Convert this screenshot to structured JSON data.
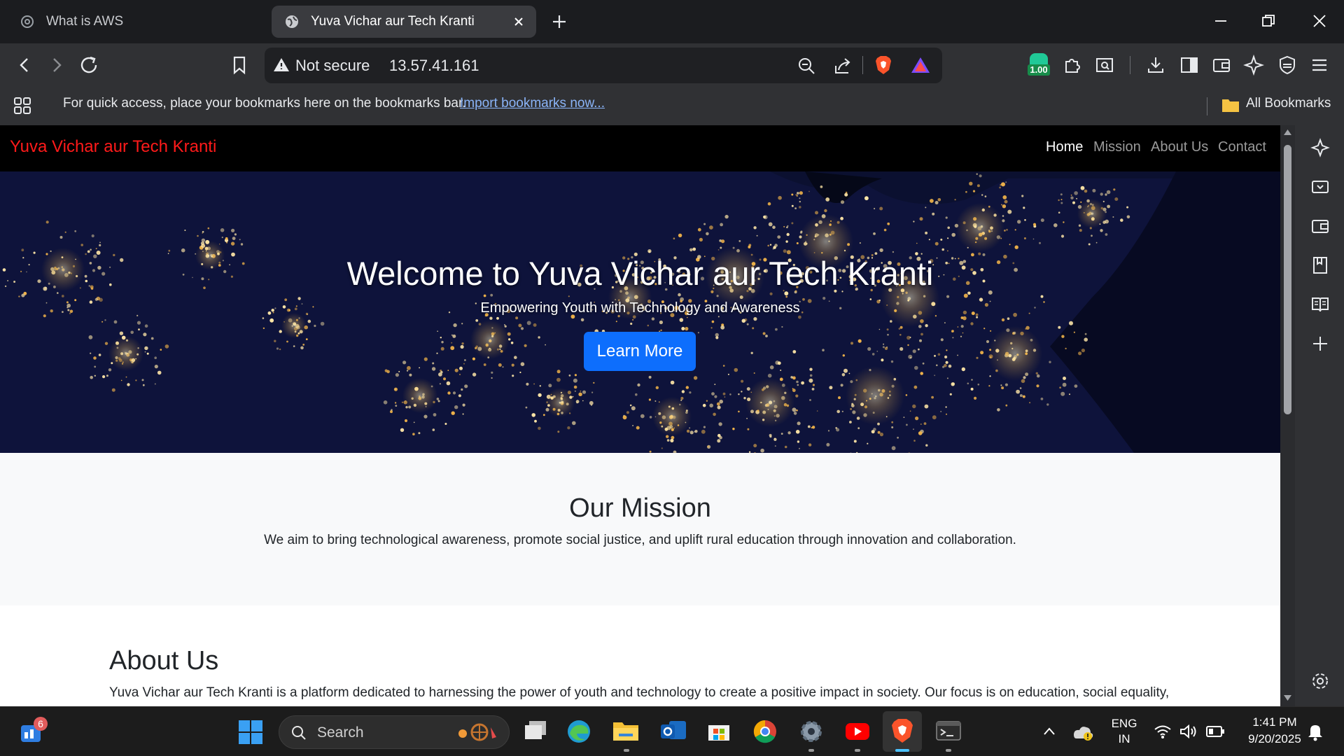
{
  "browser": {
    "tabs": [
      {
        "title": "What is AWS",
        "active": false
      },
      {
        "title": "Yuva Vichar aur Tech Kranti",
        "active": true
      }
    ],
    "security_label": "Not secure",
    "url": "13.57.41.161",
    "rewards_badge": "1.00",
    "bookmarks_bar": {
      "message": "For quick access, place your bookmarks here on the bookmarks bar.",
      "import_link": "Import bookmarks now...",
      "all_bookmarks": "All Bookmarks"
    }
  },
  "site": {
    "brand": "Yuva Vichar aur Tech Kranti",
    "brand_color": "#ff1a1a",
    "nav": [
      {
        "label": "Home",
        "active": true
      },
      {
        "label": "Mission",
        "active": false
      },
      {
        "label": "About Us",
        "active": false
      },
      {
        "label": "Contact",
        "active": false
      }
    ],
    "hero": {
      "title": "Welcome to Yuva Vichar aur Tech Kranti",
      "subtitle": "Empowering Youth with Technology and Awareness",
      "button": "Learn More",
      "button_color": "#0d6efd"
    },
    "mission": {
      "heading": "Our Mission",
      "text": "We aim to bring technological awareness, promote social justice, and uplift rural education through innovation and collaboration."
    },
    "about": {
      "heading": "About Us",
      "text": "Yuva Vichar aur Tech Kranti is a platform dedicated to harnessing the power of youth and technology to create a positive impact in society. Our focus is on education, social equality,"
    }
  },
  "taskbar": {
    "widgets_badge": "6",
    "search_placeholder": "Search",
    "language_line1": "ENG",
    "language_line2": "IN",
    "time": "1:41 PM",
    "date": "9/20/2025"
  }
}
